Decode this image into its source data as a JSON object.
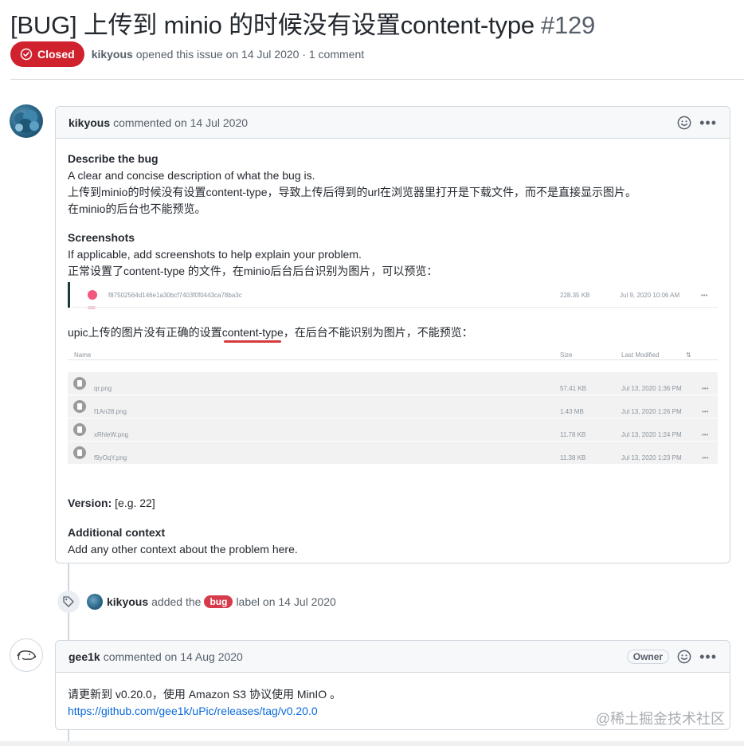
{
  "issue": {
    "title": "[BUG] 上传到 minio 的时候没有设置content-type",
    "number": "#129",
    "state": "Closed",
    "author": "kikyous",
    "opened_text": "opened this issue on 14 Jul 2020 · 1 comment"
  },
  "comment1": {
    "author": "kikyous",
    "header_text": "commented on 14 Jul 2020",
    "describe_heading": "Describe the bug",
    "describe_line1": "A clear and concise description of what the bug is.",
    "describe_line2": "上传到minio的时候没有设置content-type，导致上传后得到的url在浏览器里打开是下载文件，而不是直接显示图片。",
    "describe_line3": "在minio的后台也不能预览。",
    "screenshots_heading": "Screenshots",
    "screenshots_line1": "If applicable, add screenshots to help explain your problem.",
    "screenshots_line2": "正常设置了content-type 的文件，在minio后台后台识别为图片，可以预览：",
    "shot1": {
      "filename": "f87502564d146e1a30bcf7403f0f0443ca78ba3c",
      "size": "228.35 KB",
      "date": "Jul 9, 2020 10:06 AM",
      "more": "•••"
    },
    "upic_prefix": "upic上传的图片没有正确的设置",
    "upic_highlight": "content-type",
    "upic_suffix": "，在后台不能识别为图片，不能预览：",
    "shot2": {
      "headers": {
        "name": "Name",
        "size": "Size",
        "modified": "Last Modified",
        "sort": "⇅"
      },
      "rows": [
        {
          "name": "qr.png",
          "size": "57.41 KB",
          "date": "Jul 13, 2020 1:36 PM",
          "more": "•••"
        },
        {
          "name": "f1An28.png",
          "size": "1.43 MB",
          "date": "Jul 13, 2020 1:26 PM",
          "more": "•••"
        },
        {
          "name": "xRhleW.png",
          "size": "11.78 KB",
          "date": "Jul 13, 2020 1:24 PM",
          "more": "•••"
        },
        {
          "name": "f9yOqY.png",
          "size": "11.38 KB",
          "date": "Jul 13, 2020 1:23 PM",
          "more": "•••"
        }
      ]
    },
    "version_label": "Version:",
    "version_value": "[e.g. 22]",
    "context_heading": "Additional context",
    "context_text": "Add any other context about the problem here."
  },
  "label_event": {
    "author": "kikyous",
    "added_text": "added the",
    "label": "bug",
    "suffix": "label on 14 Jul 2020"
  },
  "comment2": {
    "author": "gee1k",
    "header_text": "commented on 14 Aug 2020",
    "owner_badge": "Owner",
    "body_line": "请更新到 v0.20.0，使用 Amazon S3 协议使用 MinIO 。",
    "link_text": "https://github.com/gee1k/uPic/releases/tag/v0.20.0"
  },
  "watermark": "@稀土掘金技术社区",
  "colors": {
    "closed_red": "#cf222e",
    "bug_label": "#d73a4a",
    "link_blue": "#0969da"
  }
}
